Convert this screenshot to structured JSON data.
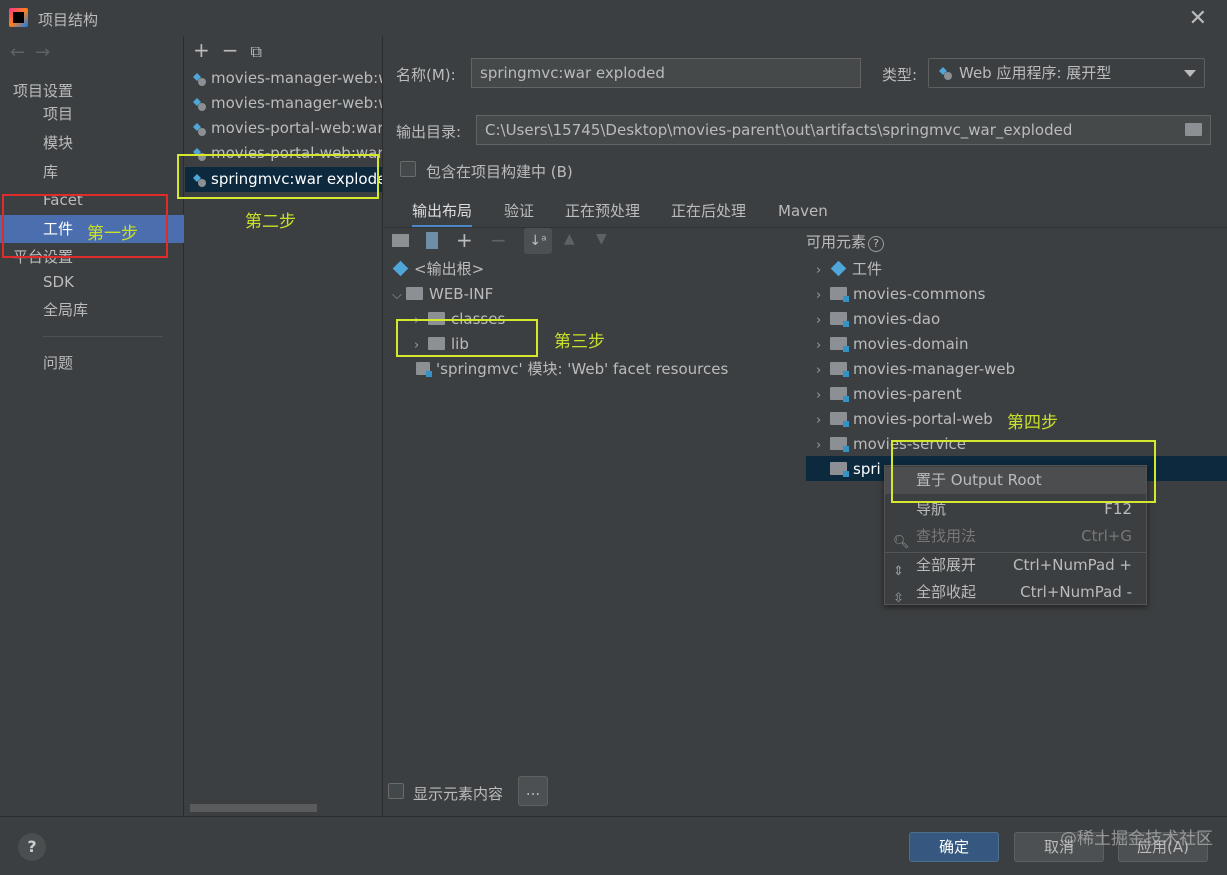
{
  "window": {
    "title": "项目结构"
  },
  "nav": {
    "project_settings_header": "项目设置",
    "project_items": [
      "项目",
      "模块",
      "库",
      "Facet",
      "工件"
    ],
    "selected": "工件",
    "platform_settings_header": "平台设置",
    "platform_items": [
      "SDK",
      "全局库"
    ],
    "problems": "问题"
  },
  "artifacts": {
    "toolbar": {
      "add": "+",
      "remove": "−",
      "copy": "⧉"
    },
    "items": [
      "movies-manager-web:w",
      "movies-manager-web:w",
      "movies-portal-web:war",
      "movies-portal-web:war",
      "springmvc:war explode"
    ],
    "selected_index": 4
  },
  "form": {
    "name_label": "名称(M):",
    "name_value": "springmvc:war exploded",
    "type_label": "类型:",
    "type_value": "Web 应用程序: 展开型",
    "output_label": "输出目录:",
    "output_value": "C:\\Users\\15745\\Desktop\\movies-parent\\out\\artifacts\\springmvc_war_exploded",
    "include_in_build_label": "包含在项目构建中 (B)"
  },
  "tabs": [
    "输出布局",
    "验证",
    "正在预处理",
    "正在后处理",
    "Maven"
  ],
  "active_tab": "输出布局",
  "layout_tree": {
    "output_root": "<输出根>",
    "web_inf": "WEB-INF",
    "classes": "classes",
    "lib": "lib",
    "facet_resources": "'springmvc' 模块: 'Web' facet resources"
  },
  "available": {
    "header": "可用元素",
    "items": [
      "工件",
      "movies-commons",
      "movies-dao",
      "movies-domain",
      "movies-manager-web",
      "movies-parent",
      "movies-portal-web",
      "movies-service",
      "spri"
    ]
  },
  "context_menu": {
    "items": [
      {
        "label": "置于 Output Root",
        "shortcut": ""
      },
      {
        "label": "导航",
        "shortcut": "F12"
      },
      {
        "label": "查找用法",
        "shortcut": "Ctrl+G"
      },
      {
        "label": "全部展开",
        "shortcut": "Ctrl+NumPad +"
      },
      {
        "label": "全部收起",
        "shortcut": "Ctrl+NumPad -"
      }
    ]
  },
  "show_contents_label": "显示元素内容",
  "ellipsis": "...",
  "buttons": {
    "ok": "确定",
    "cancel": "取消",
    "apply": "应用(A)",
    "help": "?"
  },
  "annotations": {
    "step1": "第一步",
    "step2": "第二步",
    "step3": "第三步",
    "step4": "第四步"
  },
  "watermark": "@稀土掘金技术社区",
  "colors": {
    "accent": "#4b6eaf",
    "annotation": "#c8e02a",
    "red_box": "#e02b2b"
  }
}
